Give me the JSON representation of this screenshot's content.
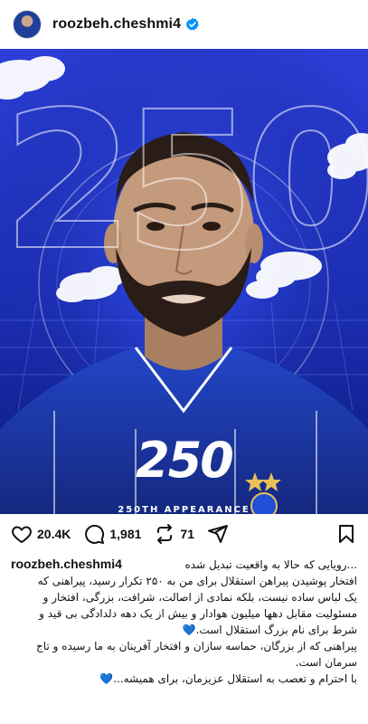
{
  "header": {
    "username": "roozbeh.cheshmi4",
    "verified_icon": "verified-badge-icon"
  },
  "post": {
    "big_number": "250",
    "overlay_number": "250",
    "appearance_label": "250TH APPEARANCE"
  },
  "actions": {
    "likes": "20.4K",
    "comments": "1,981",
    "reposts": "71",
    "icons": [
      "heart-icon",
      "comment-icon",
      "repost-icon",
      "share-icon",
      "bookmark-icon"
    ]
  },
  "caption": {
    "username": "roozbeh.cheshmi4",
    "line1": "...رویایی که حالا به واقعیت تبدیل شده",
    "line2": "افتخار پوشیدن پیراهن استقلال برای من به ۲۵۰ تکرار رسید، پیراهنی که",
    "line3": "یک لباس ساده نیست، بلکه نمادی از اصالت، شرافت، بزرگی، افتخار و",
    "line4": "مسئولیت مقابل دهها میلیون هوادار و بیش از یک دهه دلدادگی بی قید و",
    "line5": "شرط برای نام بزرگ استقلال است.",
    "line6": "پیراهنی که از بزرگان، حماسه سازان و افتخار آفرینان به ما رسیده و تاج",
    "line7": "سرمان است.",
    "line8": "با احترام و تعصب به استقلال عزیزمان، برای همیشه...",
    "emoji": "💙"
  },
  "colors": {
    "post_blue": "#1f33c4",
    "badge_blue": "#0095f6"
  }
}
